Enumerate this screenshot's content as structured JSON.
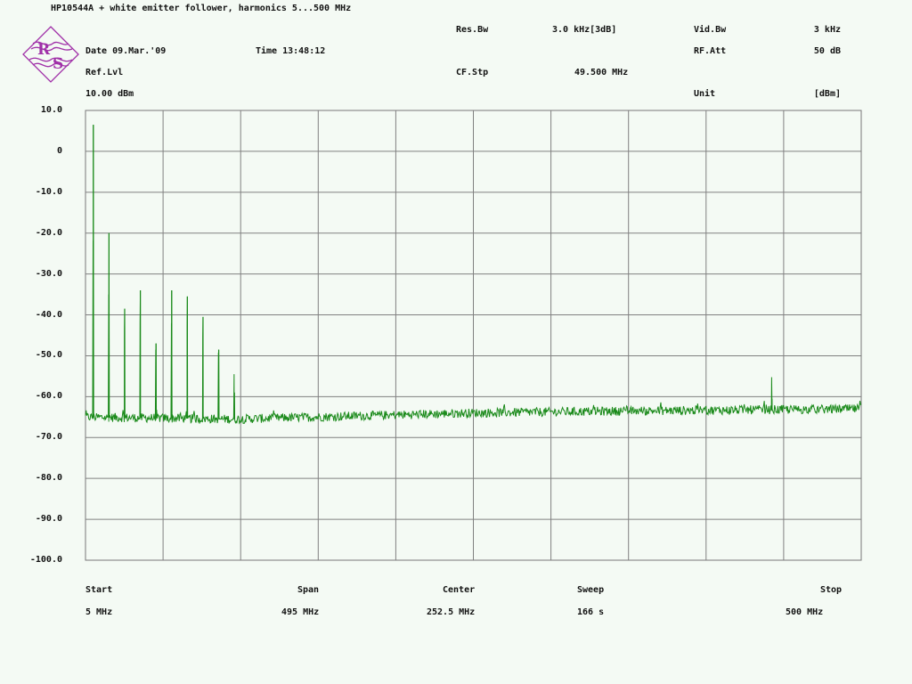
{
  "header": {
    "title": "HP10544A + white emitter follower, harmonics 5...500 MHz",
    "date": "Date 09.Mar.'09",
    "time": "Time 13:48:12",
    "ref_lvl_label": "Ref.Lvl",
    "ref_lvl_value": "10.00 dBm",
    "res_bw_label": "Res.Bw",
    "res_bw_value": "3.0 kHz[3dB]",
    "cf_stp_label": "CF.Stp",
    "cf_stp_value": "49.500 MHz",
    "vid_bw_label": "Vid.Bw",
    "vid_bw_value": "3 kHz",
    "rf_att_label": "RF.Att",
    "rf_att_value": "50 dB",
    "unit_label": "Unit",
    "unit_value": "[dBm]"
  },
  "logo": {
    "letters": [
      "R",
      "S"
    ],
    "color": "#a030a8"
  },
  "footer": {
    "start_label": "Start",
    "start_value": "5 MHz",
    "span_label": "Span",
    "span_value": "495 MHz",
    "center_label": "Center",
    "center_value": "252.5 MHz",
    "sweep_label": "Sweep",
    "sweep_value": "166 s",
    "stop_label": "Stop",
    "stop_value": "500 MHz"
  },
  "chart_data": {
    "type": "line",
    "title": "HP10544A + white emitter follower, harmonics 5...500 MHz",
    "xlabel": "",
    "ylabel": "",
    "x_range_mhz": [
      5,
      500
    ],
    "ylim": [
      -100,
      10
    ],
    "y_ticks": [
      "10.0",
      "0",
      "-10.0",
      "-20.0",
      "-30.0",
      "-40.0",
      "-50.0",
      "-60.0",
      "-70.0",
      "-80.0",
      "-90.0",
      "-100.0"
    ],
    "grid": true,
    "grid_divisions_x": 10,
    "trace_color": "#1a8a1a",
    "noise_floor_dbm": [
      {
        "x": 5,
        "y": -65
      },
      {
        "x": 100,
        "y": -65.5
      },
      {
        "x": 150,
        "y": -65
      },
      {
        "x": 250,
        "y": -64
      },
      {
        "x": 350,
        "y": -63.5
      },
      {
        "x": 500,
        "y": -63
      }
    ],
    "peaks": [
      {
        "x_mhz": 10,
        "y_dbm": 6.5
      },
      {
        "x_mhz": 20,
        "y_dbm": -20
      },
      {
        "x_mhz": 30,
        "y_dbm": -38.5
      },
      {
        "x_mhz": 40,
        "y_dbm": -34
      },
      {
        "x_mhz": 50,
        "y_dbm": -47
      },
      {
        "x_mhz": 60,
        "y_dbm": -34
      },
      {
        "x_mhz": 70,
        "y_dbm": -35.5
      },
      {
        "x_mhz": 80,
        "y_dbm": -40.5
      },
      {
        "x_mhz": 90,
        "y_dbm": -48.5
      },
      {
        "x_mhz": 100,
        "y_dbm": -59
      },
      {
        "x_mhz": 443,
        "y_dbm": -60.5
      }
    ]
  }
}
